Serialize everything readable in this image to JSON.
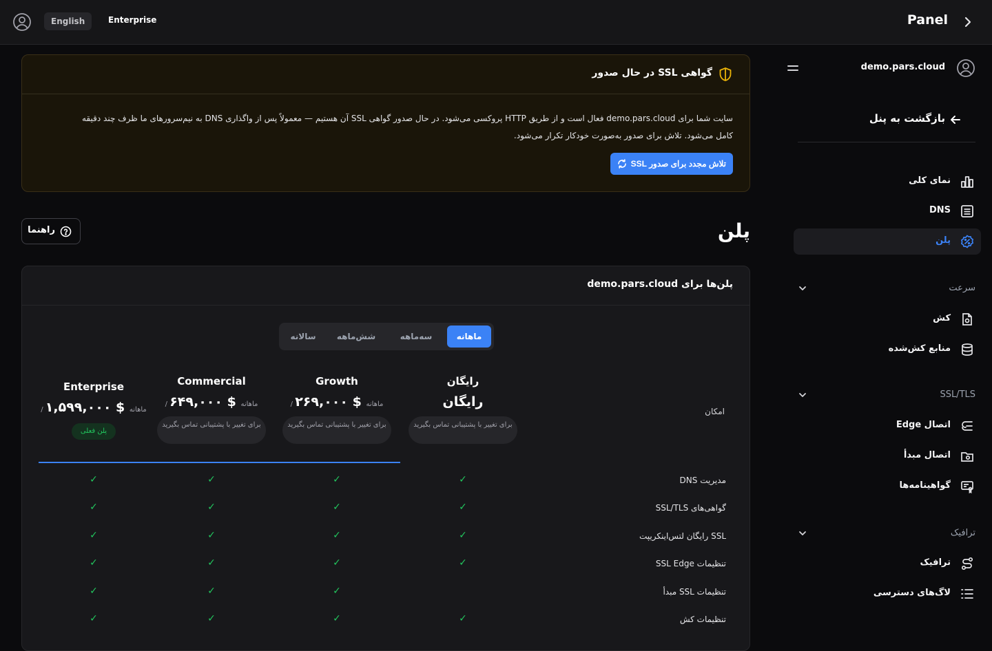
{
  "topbar": {
    "language": "English",
    "plan": "Enterprise",
    "title": "Panel"
  },
  "sidebar": {
    "site": "demo.pars.cloud",
    "back": "بازگشت به پنل",
    "items": [
      {
        "label": "نمای کلی",
        "icon": "bar-chart-icon"
      },
      {
        "label": "DNS",
        "icon": "list-icon"
      },
      {
        "label": "پلن",
        "icon": "badge-percent-icon"
      }
    ],
    "sections": [
      {
        "label": "سرعت",
        "items": [
          {
            "label": "کش",
            "icon": "file-gear-icon"
          },
          {
            "label": "منابع کش‌شده",
            "icon": "database-icon"
          }
        ]
      },
      {
        "label": "SSL/TLS",
        "items": [
          {
            "label": "اتصال Edge",
            "icon": "edge-icon"
          },
          {
            "label": "اتصال مبدأ",
            "icon": "folder-link-icon"
          },
          {
            "label": "گواهینامه‌ها",
            "icon": "certificate-icon"
          }
        ]
      },
      {
        "label": "ترافیک",
        "items": [
          {
            "label": "ترافیک",
            "icon": "route-icon"
          },
          {
            "label": "لاگ‌های دسترسی",
            "icon": "log-list-icon"
          }
        ]
      }
    ]
  },
  "ssl_notice": {
    "title": "گواهی SSL در حال صدور",
    "line1": "سایت شما برای demo.pars.cloud فعال است و از طریق HTTP پروکسی می‌شود. در حال صدور گواهی SSL آن هستیم — معمولاً پس از واگذاری DNS به نیم‌سرورهای ما ظرف چند دقیقه",
    "line2": "کامل می‌شود. تلاش برای صدور به‌صورت خودکار تکرار می‌شود.",
    "retry": "تلاش مجدد برای صدور SSL"
  },
  "page": {
    "title": "پلن",
    "guide": "راهنما"
  },
  "plans": {
    "title": "پلن‌ها برای demo.pars.cloud",
    "tabs": [
      "ماهانه",
      "سه‌ماهه",
      "شش‌ماهه",
      "سالانه"
    ],
    "feature_header": "امکان",
    "columns": [
      {
        "name": "رایگان",
        "price": "رایگان",
        "unit": "",
        "note": "برای تغییر با پشتیبانی تماس بگیرید"
      },
      {
        "name": "Growth",
        "price": "$ ۲۶۹,۰۰۰",
        "unit": "/ ماهانه",
        "note": "برای تغییر با پشتیبانی تماس بگیرید"
      },
      {
        "name": "Commercial",
        "price": "$ ۶۴۹,۰۰۰",
        "unit": "/ ماهانه",
        "note": "برای تغییر با پشتیبانی تماس بگیرید"
      },
      {
        "name": "Enterprise",
        "price": "$ ۱,۵۹۹,۰۰۰",
        "unit": "/ ماهانه",
        "current": "پلن فعلی"
      }
    ],
    "check": "✓",
    "features": [
      {
        "label": "مدیریت DNS",
        "availability": [
          true,
          true,
          true,
          true
        ]
      },
      {
        "label": "گواهی‌های SSL/TLS",
        "availability": [
          true,
          true,
          true,
          true
        ]
      },
      {
        "label": "SSL رایگان لتس‌اینکریپت",
        "availability": [
          true,
          true,
          true,
          true
        ]
      },
      {
        "label": "تنظیمات SSL Edge",
        "availability": [
          true,
          true,
          true,
          true
        ]
      },
      {
        "label": "تنظیمات SSL مبدأ",
        "availability": [
          false,
          true,
          true,
          true
        ]
      },
      {
        "label": "تنظیمات کش",
        "availability": [
          true,
          true,
          true,
          true
        ]
      }
    ]
  },
  "colors": {
    "accent": "#3b82f6",
    "success": "#22c55e",
    "warning": "#eab308"
  }
}
